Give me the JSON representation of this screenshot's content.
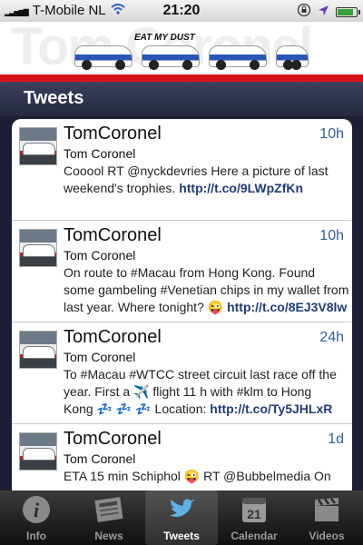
{
  "status_bar": {
    "carrier": "T-Mobile NL",
    "time": "21:20"
  },
  "banner": {
    "background_text": "Tom Coronel",
    "logo_text": "EAT MY DUST"
  },
  "nav": {
    "title": "Tweets"
  },
  "tweets": [
    {
      "name": "TomCoronel",
      "username": "Tom Coronel",
      "time": "10h",
      "text1": "Cooool RT @nyckdevries Here a picture of last",
      "text2": "weekend's trophies. ",
      "link": "http://t.co/9LWpZfKn",
      "text3": ""
    },
    {
      "name": "TomCoronel",
      "username": "Tom Coronel",
      "time": "10h",
      "text1": "On route to #Macau from Hong Kong. Found",
      "text2": "some gambeling #Venetian chips in my wallet from",
      "text3": "last year. Where tonight? 😜 ",
      "link": "http://t.co/8EJ3V8lw"
    },
    {
      "name": "TomCoronel",
      "username": "Tom Coronel",
      "time": "24h",
      "text1": "To #Macau #WTCC street circuit last race off the",
      "text2": "year. First a ✈️ flight 11 h with #klm to Hong",
      "text3": "Kong 💤 💤 💤  Location: ",
      "link": "http://t.co/Ty5JHLxR"
    },
    {
      "name": "TomCoronel",
      "username": "Tom Coronel",
      "time": "1d",
      "text1": "ETA 15 min Schiphol 😜 RT @Bubbelmedia On",
      "text2": "",
      "text3": "",
      "link": ""
    }
  ],
  "tabs": [
    {
      "label": "Info",
      "icon": "info-icon"
    },
    {
      "label": "News",
      "icon": "newspaper-icon"
    },
    {
      "label": "Tweets",
      "icon": "twitter-bird-icon"
    },
    {
      "label": "Calendar",
      "icon": "calendar-icon",
      "calendar_day": "21"
    },
    {
      "label": "Videos",
      "icon": "clapperboard-icon"
    }
  ],
  "colors": {
    "accent_red": "#d8121b",
    "link_blue": "#1f3d7a",
    "time_blue": "#2f5fa6",
    "nav_bg": "#25283f"
  }
}
